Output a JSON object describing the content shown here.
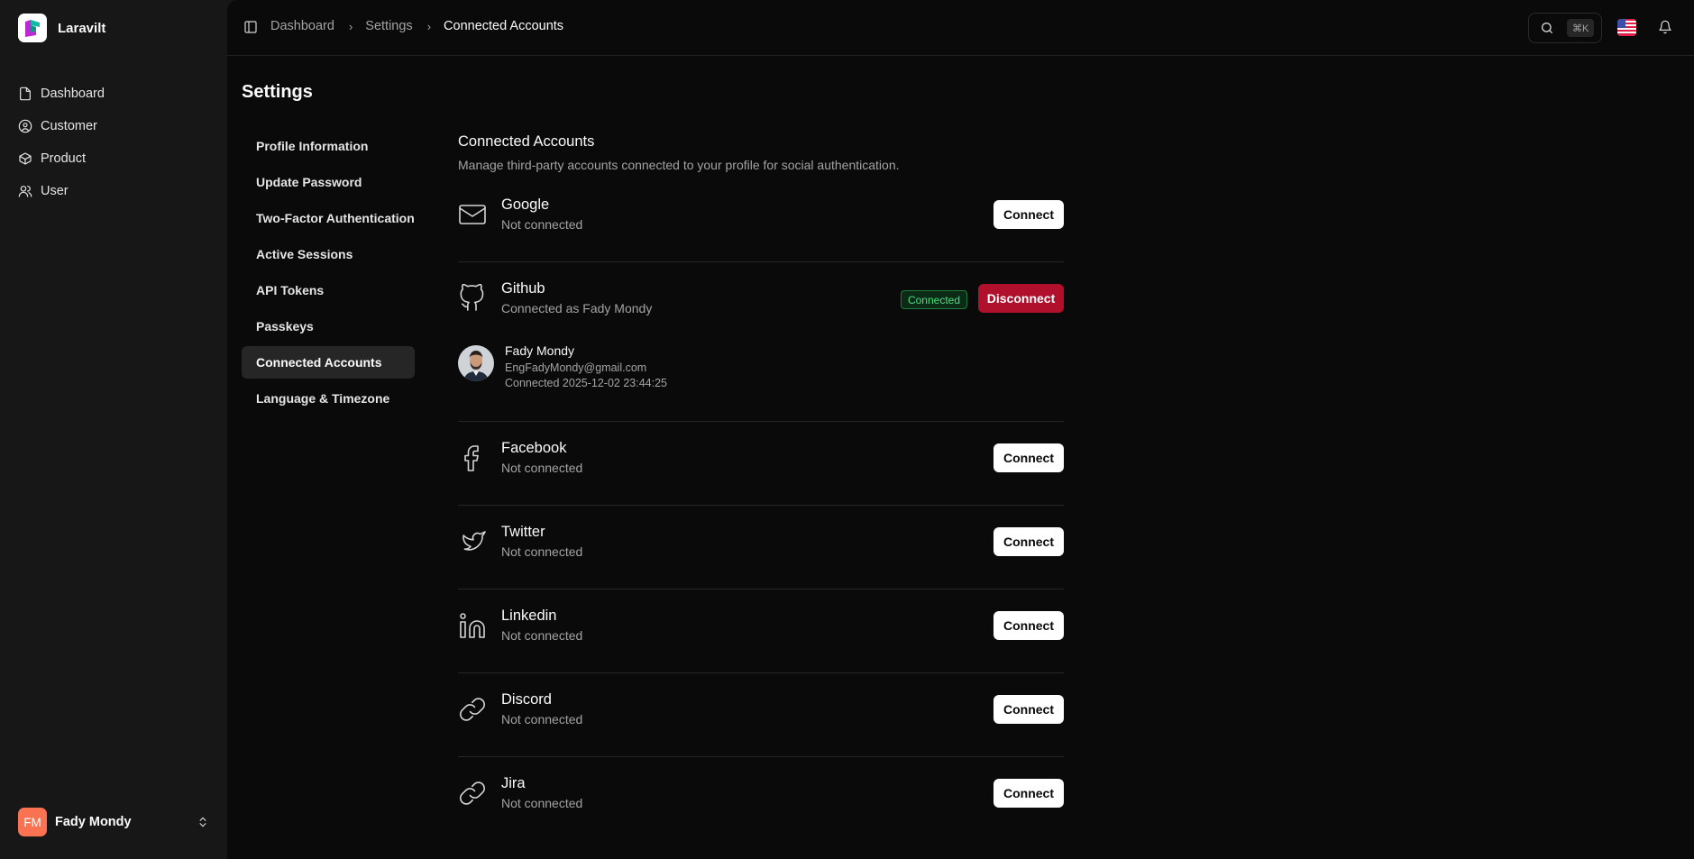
{
  "app": {
    "name": "Laravilt"
  },
  "sidebar": {
    "items": [
      {
        "label": "Dashboard",
        "icon": "file-icon"
      },
      {
        "label": "Customer",
        "icon": "user-circle-icon"
      },
      {
        "label": "Product",
        "icon": "package-icon"
      },
      {
        "label": "User",
        "icon": "users-icon"
      }
    ],
    "user": {
      "initials": "FM",
      "name": "Fady Mondy"
    }
  },
  "topbar": {
    "breadcrumb": [
      "Dashboard",
      "Settings",
      "Connected Accounts"
    ],
    "search_shortcut": "⌘K"
  },
  "page": {
    "title": "Settings"
  },
  "settings_nav": [
    "Profile Information",
    "Update Password",
    "Two-Factor Authentication",
    "Active Sessions",
    "API Tokens",
    "Passkeys",
    "Connected Accounts",
    "Language & Timezone"
  ],
  "settings_nav_active": "Connected Accounts",
  "section": {
    "title": "Connected Accounts",
    "description": "Manage third-party accounts connected to your profile for social authentication."
  },
  "providers": {
    "google": {
      "name": "Google",
      "status": "Not connected",
      "action": "Connect",
      "icon": "mail-icon"
    },
    "github": {
      "name": "Github",
      "status": "Connected as Fady Mondy",
      "badge": "Connected",
      "action": "Disconnect",
      "icon": "github-icon",
      "account": {
        "name": "Fady Mondy",
        "email": "EngFadyMondy@gmail.com",
        "connected_at": "Connected 2025-12-02 23:44:25"
      }
    },
    "facebook": {
      "name": "Facebook",
      "status": "Not connected",
      "action": "Connect",
      "icon": "facebook-icon"
    },
    "twitter": {
      "name": "Twitter",
      "status": "Not connected",
      "action": "Connect",
      "icon": "twitter-icon"
    },
    "linkedin": {
      "name": "Linkedin",
      "status": "Not connected",
      "action": "Connect",
      "icon": "linkedin-icon"
    },
    "discord": {
      "name": "Discord",
      "status": "Not connected",
      "action": "Connect",
      "icon": "link-icon"
    },
    "jira": {
      "name": "Jira",
      "status": "Not connected",
      "action": "Connect",
      "icon": "link-icon"
    }
  },
  "colors": {
    "background": "#0a0a0a",
    "sidebar": "#171717",
    "danger": "#b0102c",
    "success": "#4ade80",
    "avatar": "#f97352"
  }
}
